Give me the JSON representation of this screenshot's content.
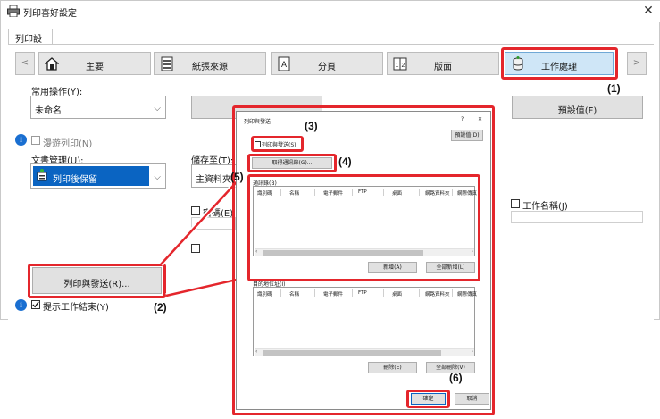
{
  "window": {
    "title": "列印喜好設定",
    "close_glyph": "✕"
  },
  "tabs": [
    {
      "label": "列印設定"
    }
  ],
  "nav": {
    "prev_glyph": "<",
    "next_glyph": ">",
    "items": [
      {
        "label": "主要"
      },
      {
        "label": "紙張來源"
      },
      {
        "label": "分頁"
      },
      {
        "label": "版面"
      },
      {
        "label": "工作處理"
      }
    ]
  },
  "common_ops": {
    "label": "常用操作(Y):",
    "value": "未命名",
    "save_button": "",
    "defaults_button": "預設值(F)"
  },
  "roaming_print": {
    "label": "漫遊列印(N)"
  },
  "retention": {
    "label": "文書管理(U):",
    "value": "列印後保留"
  },
  "store_to": {
    "label": "儲存至(T):",
    "value": "主資料夾"
  },
  "pin_code": {
    "label": "密碼(E)"
  },
  "job_name": {
    "label": "工作名稱(J)"
  },
  "print_and_send_button": "列印與發送(R)...",
  "show_job_end": {
    "label": "提示工作結束(Y)"
  },
  "dialog": {
    "title": "列印與發送",
    "help_glyph": "?",
    "close_glyph": "✕",
    "defaults_button": "預設值(D)",
    "checkbox_label": "列印與發送(S)",
    "get_address_button": "取得通訊錄(G)...",
    "address_book_label": "通訊錄(B)",
    "columns": [
      "識別碼",
      "名稱",
      "電子郵件",
      "FTP",
      "桌面",
      "網路資料夾",
      "網際傳真"
    ],
    "add_button": "新增(A)",
    "add_all_button": "全部新增(L)",
    "recipients_label": "目的地位址(I)",
    "remove_button": "刪除(E)",
    "remove_all_button": "全部刪除(V)",
    "ok_button": "確定",
    "cancel_button": "取消"
  },
  "callouts": {
    "c1": "(1)",
    "c2": "(2)",
    "c3": "(3)",
    "c4": "(4)",
    "c5": "(5)",
    "c6": "(6)"
  },
  "colors": {
    "highlight_red": "#e4262c",
    "selected_blue": "#0a64c2",
    "info_blue": "#1a6fd1"
  }
}
